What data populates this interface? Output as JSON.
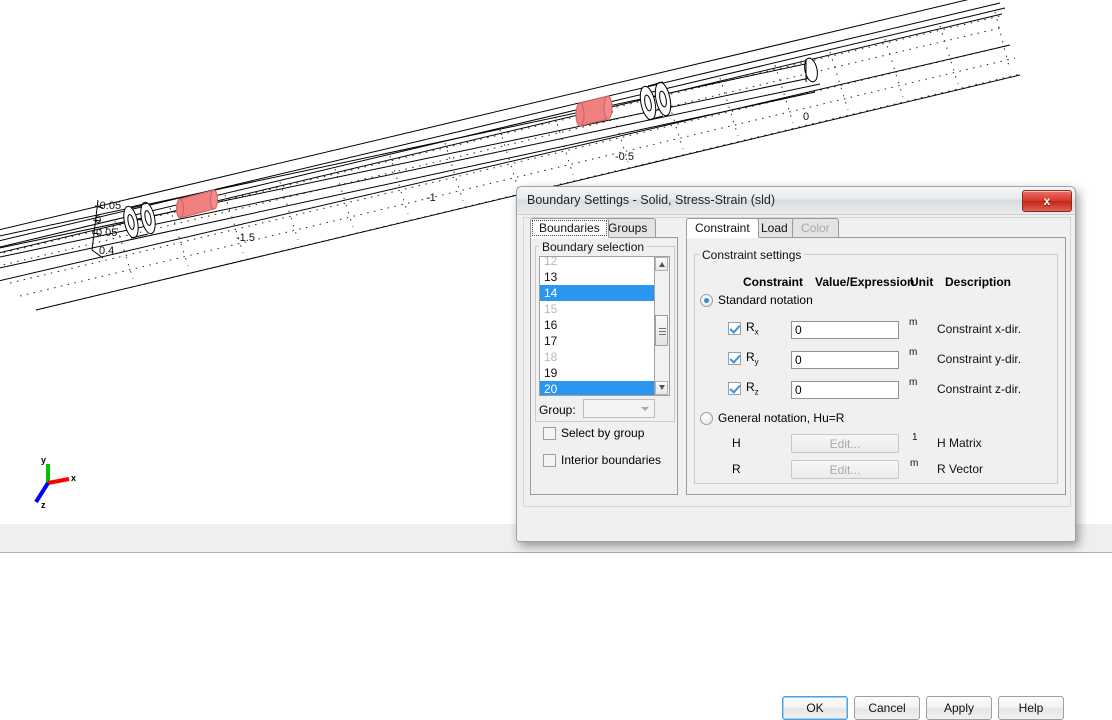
{
  "graphics": {
    "axis_labels_x": [
      "-1.5",
      "-1",
      "-0.5",
      "0"
    ],
    "axis_labels_y": [
      "-0.05",
      "0",
      "0.05",
      "0.4"
    ],
    "triad": {
      "x": "x",
      "y": "y",
      "z": "z",
      "x_color": "#ff0000",
      "y_color": "#00c000",
      "z_color": "#0000ff"
    },
    "highlight_color": "#f08080",
    "edge_color": "#000000"
  },
  "dialog": {
    "title": "Boundary Settings - Solid, Stress-Strain (sld)",
    "close_label": "x",
    "left_tabs": [
      {
        "label": "Boundaries",
        "active": true,
        "focused": true,
        "disabled": false
      },
      {
        "label": "Groups",
        "active": false,
        "focused": false,
        "disabled": false
      }
    ],
    "right_tabs": [
      {
        "label": "Constraint",
        "active": true,
        "focused": false,
        "disabled": false
      },
      {
        "label": "Load",
        "active": false,
        "focused": false,
        "disabled": false
      },
      {
        "label": "Color",
        "active": false,
        "focused": false,
        "disabled": true
      }
    ],
    "boundary_selection": {
      "group_title": "Boundary selection",
      "items": [
        {
          "label": "12",
          "state": "dim"
        },
        {
          "label": "13",
          "state": "normal"
        },
        {
          "label": "14",
          "state": "selected"
        },
        {
          "label": "15",
          "state": "dim"
        },
        {
          "label": "16",
          "state": "normal"
        },
        {
          "label": "17",
          "state": "normal"
        },
        {
          "label": "18",
          "state": "dim"
        },
        {
          "label": "19",
          "state": "normal"
        },
        {
          "label": "20",
          "state": "selected"
        }
      ],
      "group_label": "Group:",
      "group_value": "",
      "select_by_group": {
        "label": "Select by group",
        "checked": false
      },
      "interior_boundaries": {
        "label": "Interior boundaries",
        "checked": false
      }
    },
    "constraint_settings": {
      "group_title": "Constraint settings",
      "columns": [
        "Constraint",
        "Value/Expression",
        "Unit",
        "Description"
      ],
      "standard_notation": {
        "label": "Standard notation",
        "selected": true
      },
      "rows": [
        {
          "name": "R",
          "sub": "x",
          "checked": true,
          "value": "0",
          "unit": "m",
          "description": "Constraint x-dir."
        },
        {
          "name": "R",
          "sub": "y",
          "checked": true,
          "value": "0",
          "unit": "m",
          "description": "Constraint y-dir."
        },
        {
          "name": "R",
          "sub": "z",
          "checked": true,
          "value": "0",
          "unit": "m",
          "description": "Constraint z-dir."
        }
      ],
      "general_notation": {
        "label": "General notation, Hu=R",
        "selected": false
      },
      "general_rows": [
        {
          "name": "H",
          "button": "Edit...",
          "unit": "1",
          "description": "H Matrix"
        },
        {
          "name": "R",
          "button": "Edit...",
          "unit": "m",
          "description": "R Vector"
        }
      ]
    },
    "buttons": [
      {
        "label": "OK",
        "primary": true
      },
      {
        "label": "Cancel",
        "primary": false
      },
      {
        "label": "Apply",
        "primary": false
      },
      {
        "label": "Help",
        "primary": false
      }
    ]
  }
}
